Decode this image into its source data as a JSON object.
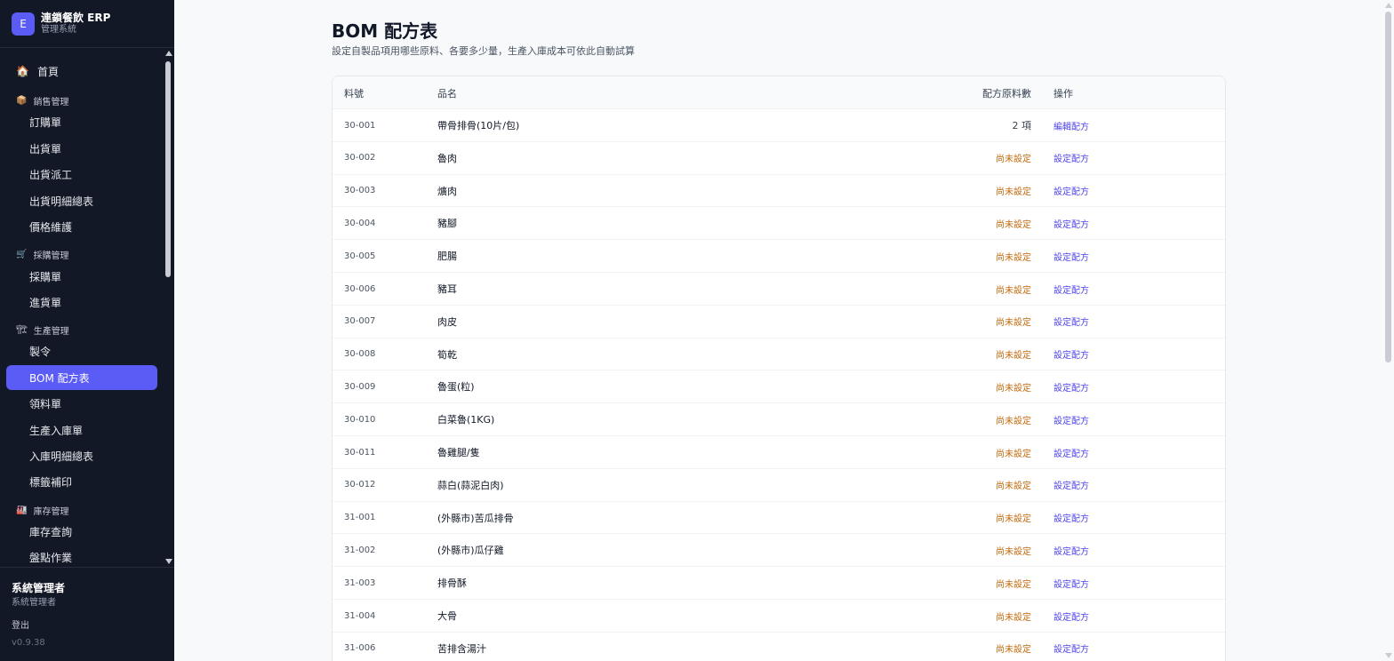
{
  "brand": {
    "logo_letter": "E",
    "title": "連鎖餐飲 ERP",
    "subtitle": "管理系統"
  },
  "nav": {
    "home": {
      "icon": "home-icon",
      "label": "首頁"
    },
    "groups": [
      {
        "icon": "box-icon",
        "label": "銷售管理"
      },
      {
        "icon": "cart-icon",
        "label": "採購管理"
      },
      {
        "icon": "factory-icon",
        "label": "生產管理"
      },
      {
        "icon": "warehouse-icon",
        "label": "庫存管理"
      }
    ],
    "items": [
      {
        "label": "訂購單"
      },
      {
        "label": "出貨單"
      },
      {
        "label": "出貨派工"
      },
      {
        "label": "出貨明細總表"
      },
      {
        "label": "價格維護"
      },
      {
        "label": "採購單"
      },
      {
        "label": "進貨單"
      },
      {
        "label": "製令"
      },
      {
        "label": "BOM 配方表",
        "active": true
      },
      {
        "label": "領料單"
      },
      {
        "label": "生產入庫單"
      },
      {
        "label": "入庫明細總表"
      },
      {
        "label": "標籤補印"
      },
      {
        "label": "庫存查詢"
      },
      {
        "label": "盤點作業"
      }
    ]
  },
  "footer": {
    "user_name": "系統管理者",
    "user_role": "系統管理者",
    "logout": "登出",
    "version": "v0.9.38"
  },
  "page": {
    "title": "BOM 配方表",
    "subtitle": "設定自製品項用哪些原料、各要多少量，生產入庫成本可依此自動試算"
  },
  "table": {
    "columns": {
      "code": "料號",
      "name": "品名",
      "count": "配方原料數",
      "op": "操作"
    },
    "rows": [
      {
        "code": "30-001",
        "name": "帶骨排骨(10片/包)",
        "count": "2 項",
        "set": true,
        "op": "編輯配方"
      },
      {
        "code": "30-002",
        "name": "魯肉",
        "count": "尚未設定",
        "set": false,
        "op": "設定配方"
      },
      {
        "code": "30-003",
        "name": "爌肉",
        "count": "尚未設定",
        "set": false,
        "op": "設定配方"
      },
      {
        "code": "30-004",
        "name": "豬腳",
        "count": "尚未設定",
        "set": false,
        "op": "設定配方"
      },
      {
        "code": "30-005",
        "name": "肥腸",
        "count": "尚未設定",
        "set": false,
        "op": "設定配方"
      },
      {
        "code": "30-006",
        "name": "豬耳",
        "count": "尚未設定",
        "set": false,
        "op": "設定配方"
      },
      {
        "code": "30-007",
        "name": "肉皮",
        "count": "尚未設定",
        "set": false,
        "op": "設定配方"
      },
      {
        "code": "30-008",
        "name": "筍乾",
        "count": "尚未設定",
        "set": false,
        "op": "設定配方"
      },
      {
        "code": "30-009",
        "name": "魯蛋(粒)",
        "count": "尚未設定",
        "set": false,
        "op": "設定配方"
      },
      {
        "code": "30-010",
        "name": "白菜魯(1KG)",
        "count": "尚未設定",
        "set": false,
        "op": "設定配方"
      },
      {
        "code": "30-011",
        "name": "魯雞腿/隻",
        "count": "尚未設定",
        "set": false,
        "op": "設定配方"
      },
      {
        "code": "30-012",
        "name": "蒜白(蒜泥白肉)",
        "count": "尚未設定",
        "set": false,
        "op": "設定配方"
      },
      {
        "code": "31-001",
        "name": "(外縣市)苦瓜排骨",
        "count": "尚未設定",
        "set": false,
        "op": "設定配方"
      },
      {
        "code": "31-002",
        "name": "(外縣市)瓜仔雞",
        "count": "尚未設定",
        "set": false,
        "op": "設定配方"
      },
      {
        "code": "31-003",
        "name": "排骨酥",
        "count": "尚未設定",
        "set": false,
        "op": "設定配方"
      },
      {
        "code": "31-004",
        "name": "大骨",
        "count": "尚未設定",
        "set": false,
        "op": "設定配方"
      },
      {
        "code": "31-006",
        "name": "苦排含湯汁",
        "count": "尚未設定",
        "set": false,
        "op": "設定配方"
      }
    ]
  },
  "colors": {
    "accent": "#5b5bf5",
    "sidebar_bg": "#131827",
    "unset": "#c2690c",
    "link": "#4f46e5"
  }
}
